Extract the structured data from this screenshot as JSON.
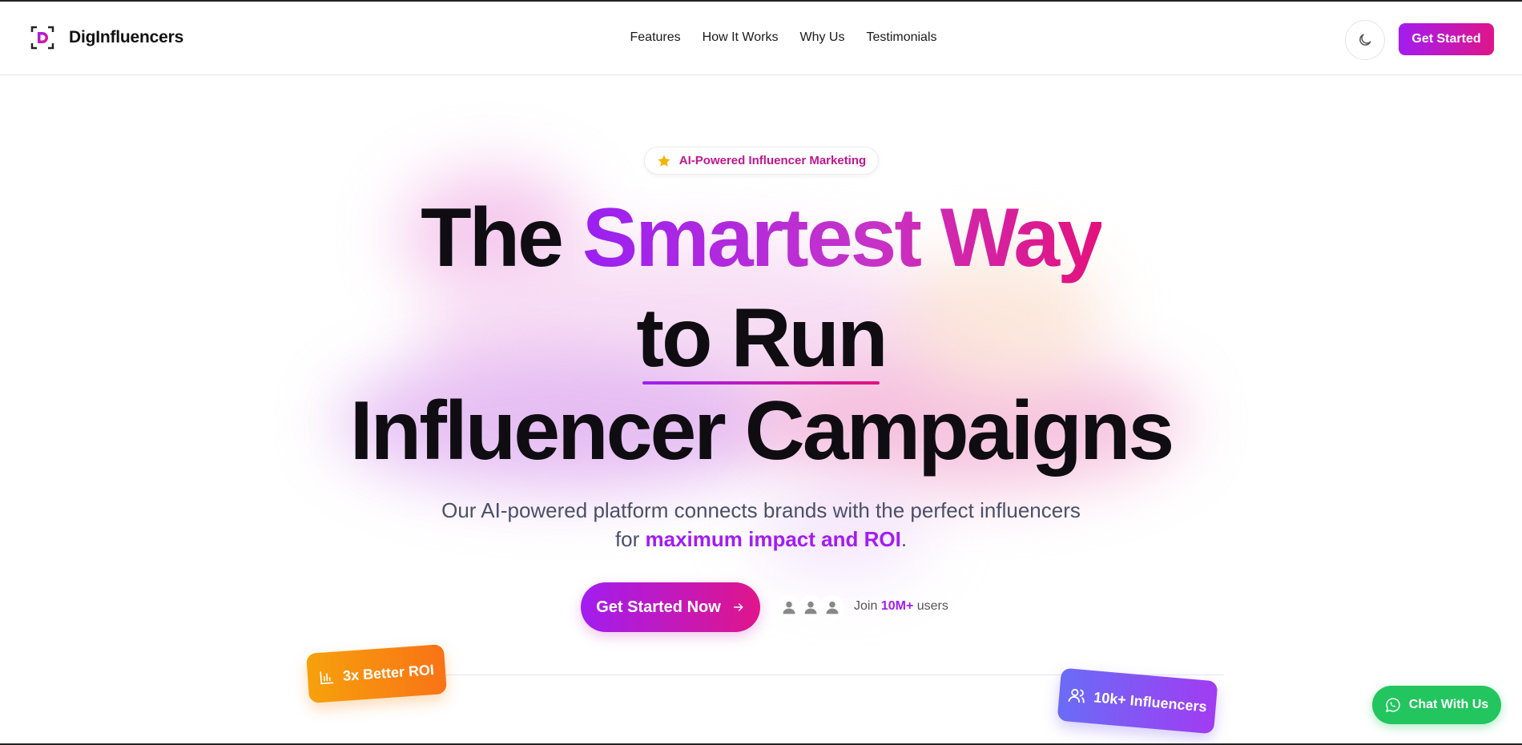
{
  "header": {
    "brand": "DigInfluencers",
    "nav": [
      "Features",
      "How It Works",
      "Why Us",
      "Testimonials"
    ],
    "cta_label": "Get Started",
    "theme_icon": "moon-icon"
  },
  "hero": {
    "badge_icon": "star-icon",
    "badge_label": "AI-Powered Influencer Marketing",
    "headline": {
      "line1_plain": "The",
      "line1_gradient": "Smartest Way",
      "line2": "to Run",
      "line3": "Influencer Campaigns"
    },
    "subtext": {
      "line1": "Our AI-powered platform connects brands with the perfect influencers",
      "line2_prefix": "for",
      "line2_highlight": "maximum impact and ROI",
      "line2_suffix": "."
    },
    "cta_label": "Get Started Now",
    "join": {
      "prefix": "Join",
      "highlight": "10M+",
      "suffix": "users"
    }
  },
  "floating_cards": {
    "roi_label": "3x Better ROI",
    "influencers_label": "10k+ Influencers"
  },
  "chat": {
    "label": "Chat With Us",
    "icon": "whatsapp-icon"
  },
  "colors": {
    "brand_gradient_start": "#a21df0",
    "brand_gradient_end": "#e0158a",
    "roi_card": "#f97316",
    "influencers_card": "#6a6cf6",
    "chat": "#22c55e"
  }
}
